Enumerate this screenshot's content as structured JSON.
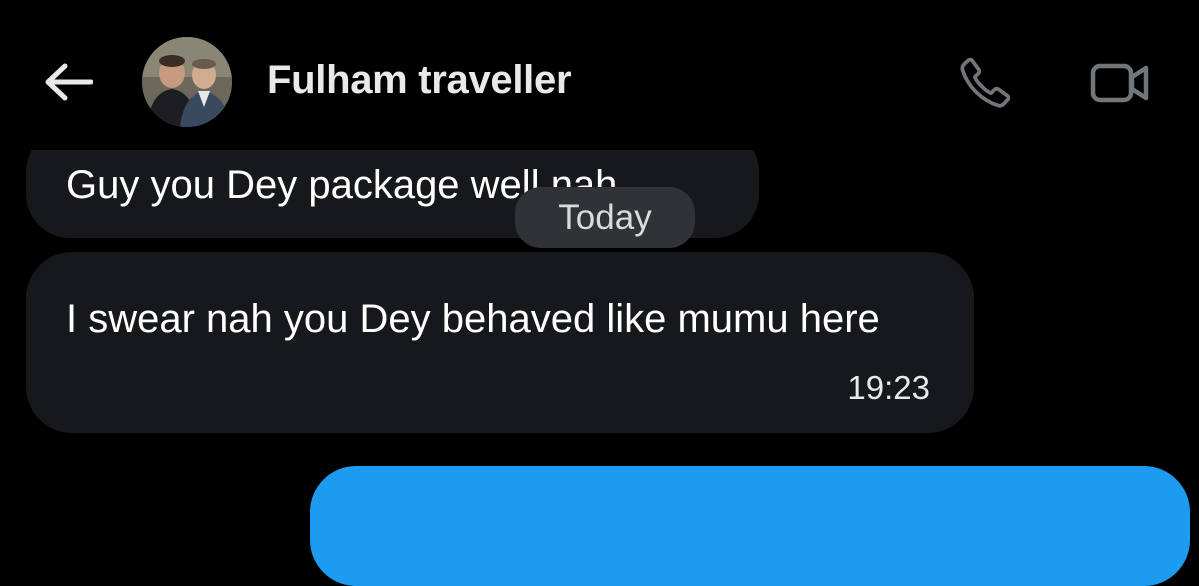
{
  "header": {
    "title": "Fulham traveller",
    "back_icon": "arrow-left-icon",
    "call_icon": "phone-icon",
    "video_icon": "video-camera-icon"
  },
  "messages": [
    {
      "direction": "received",
      "text": "Guy you Dey package well nah"
    },
    {
      "direction": "received",
      "text": "I swear nah you Dey behaved like mumu here",
      "time": "19:23"
    }
  ],
  "date_separator": "Today",
  "colors": {
    "background": "#000000",
    "received_bubble": "#16181c",
    "sent_bubble": "#1d9bf0",
    "date_pill": "#2f3336",
    "icon": "#e7e9ea",
    "icon_dim": "#71767b"
  }
}
